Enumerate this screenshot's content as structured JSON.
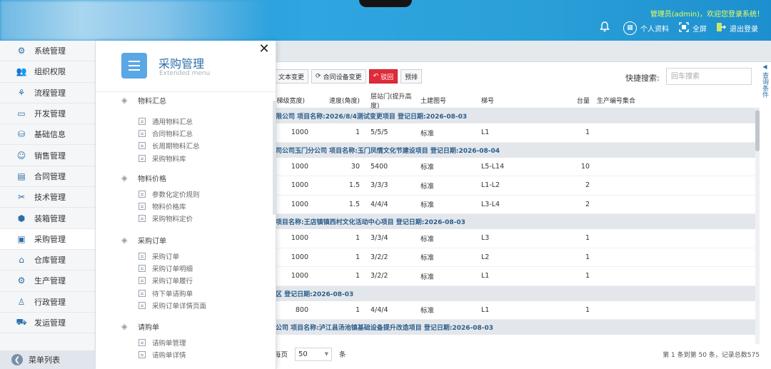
{
  "header": {
    "welcome": "管理员(admin)，欢迎您登录系统！",
    "personal": "个人资料",
    "fullscreen": "全屏",
    "logout": "退出登录"
  },
  "sidebar": {
    "items": [
      {
        "label": "系统管理",
        "icon": "settings-icon"
      },
      {
        "label": "组织权限",
        "icon": "users-icon"
      },
      {
        "label": "流程管理",
        "icon": "flow-icon"
      },
      {
        "label": "开发管理",
        "icon": "code-icon"
      },
      {
        "label": "基础信息",
        "icon": "database-icon"
      },
      {
        "label": "销售管理",
        "icon": "user-icon"
      },
      {
        "label": "合同管理",
        "icon": "contract-icon"
      },
      {
        "label": "技术管理",
        "icon": "tools-icon"
      },
      {
        "label": "装箱管理",
        "icon": "box-icon"
      },
      {
        "label": "采购管理",
        "icon": "clipboard-icon"
      },
      {
        "label": "仓库管理",
        "icon": "warehouse-icon"
      },
      {
        "label": "生产管理",
        "icon": "gear-icon"
      },
      {
        "label": "行政管理",
        "icon": "person-icon"
      },
      {
        "label": "发运管理",
        "icon": "truck-icon"
      }
    ],
    "active_index": 9,
    "footer_label": "菜单列表"
  },
  "toolbar": {
    "btn1": "文本变更",
    "btn2": "合同设备变更",
    "btn3": "驳回",
    "btn4": "预排"
  },
  "quick_search": {
    "label": "快捷搜索:",
    "placeholder": "回车搜索"
  },
  "side_tab": "查询条件",
  "table": {
    "headers": [
      "(梯级宽度)",
      "速度(角度)",
      "层站门(提升高度)",
      "土建图号",
      "梯号",
      "台量",
      "生产编号集合"
    ],
    "rows": [
      {
        "type": "group",
        "text": "限公司  项目名称:2026/8/4测试变更项目  登记日期:2026-08-03"
      },
      {
        "type": "data",
        "cells": [
          "1000",
          "1",
          "5/5/5",
          "标准",
          "L1",
          "1"
        ]
      },
      {
        "type": "group",
        "text": "司公司玉门分公司  项目名称:玉门凤情文化节建设项目  登记日期:2026-08-04"
      },
      {
        "type": "data",
        "cells": [
          "1000",
          "30",
          "5400",
          "标准",
          "L5-L14",
          "10"
        ]
      },
      {
        "type": "data",
        "cells": [
          "1000",
          "1.5",
          "3/3/3",
          "标准",
          "L1-L2",
          "2"
        ]
      },
      {
        "type": "data",
        "cells": [
          "1000",
          "1.5",
          "4/4/4",
          "标准",
          "L3-L4",
          "2"
        ]
      },
      {
        "type": "group",
        "text": "项目名称:王店镇镇西村文化活动中心项目  登记日期:2026-08-03"
      },
      {
        "type": "data",
        "cells": [
          "1000",
          "1",
          "3/3/4",
          "标准",
          "L3",
          "1"
        ]
      },
      {
        "type": "data",
        "cells": [
          "1000",
          "1",
          "3/2/2",
          "标准",
          "L2",
          "1"
        ]
      },
      {
        "type": "data",
        "cells": [
          "1000",
          "1",
          "3/2/2",
          "标准",
          "L1",
          "1"
        ]
      },
      {
        "type": "group",
        "text": "区  登记日期:2026-08-03"
      },
      {
        "type": "data",
        "cells": [
          "800",
          "1",
          "4/4/4",
          "标准",
          "L1",
          "1"
        ]
      },
      {
        "type": "group",
        "text": "公司  项目名称:泸江县汤池镇基础设备提升改造项目  登记日期:2026-08-03"
      }
    ]
  },
  "pager": {
    "per_page_label": "每页",
    "per_page": "50",
    "unit": "条",
    "info": "第 1 条到第 50 条，记录总数575"
  },
  "panel": {
    "title": "采购管理",
    "subtitle": "Extended menu",
    "categories": [
      {
        "label": "物料汇总",
        "items": [
          "通用物料汇总",
          "合同物料汇总",
          "长周期物料汇总",
          "采购物料库"
        ]
      },
      {
        "label": "物料价格",
        "items": [
          "参数化定价规则",
          "物料价格库",
          "采购物料定价"
        ]
      },
      {
        "label": "采购订单",
        "items": [
          "采购订单",
          "采购订单明细",
          "采购订单履行",
          "待下单请购单",
          "采购订单详情页面"
        ]
      },
      {
        "label": "请购单",
        "items": [
          "请购单管理",
          "请购单详情"
        ]
      }
    ]
  }
}
